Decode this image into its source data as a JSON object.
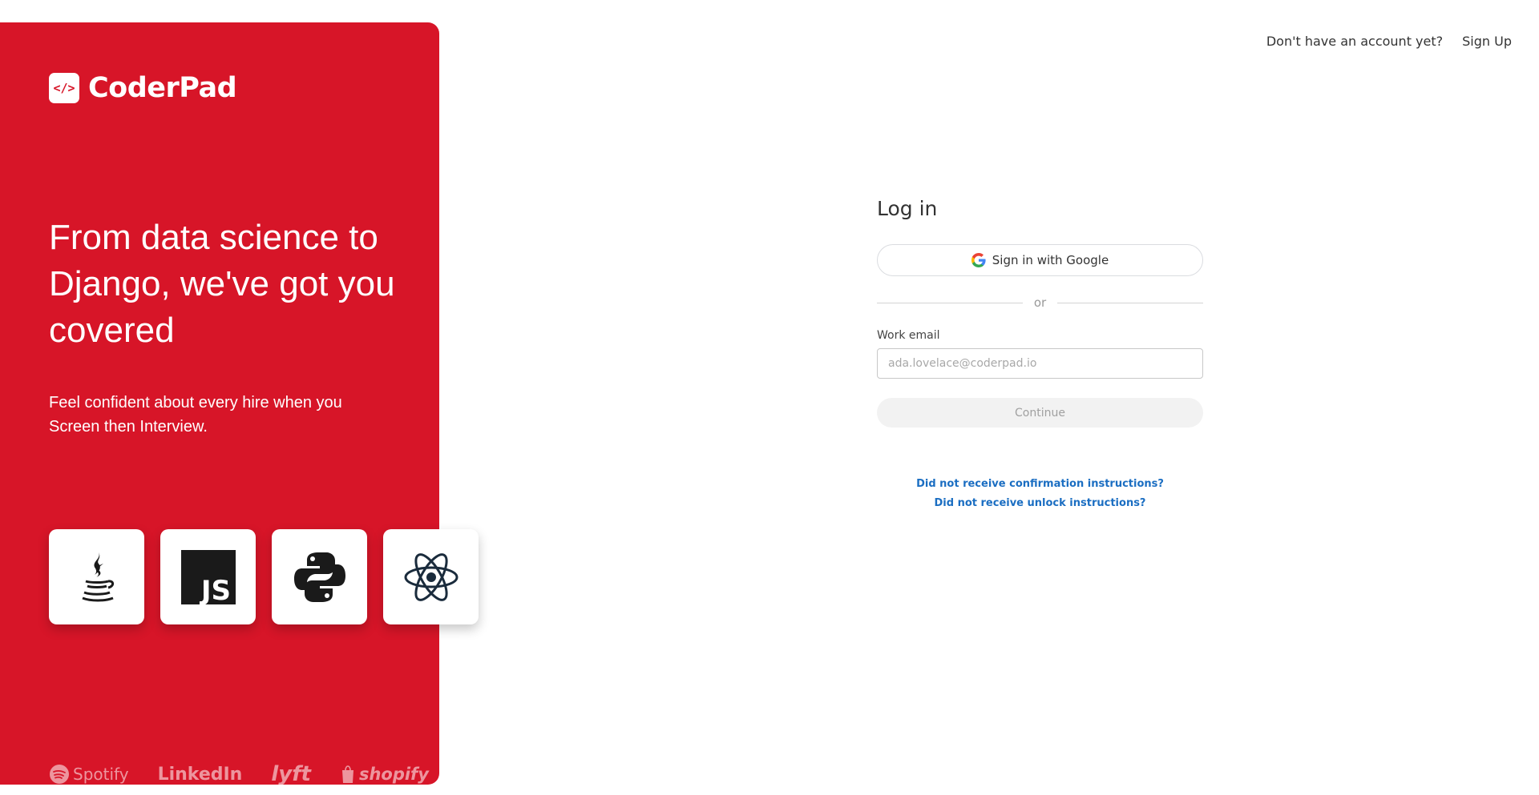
{
  "brand": {
    "logo_mark": "</>",
    "name": "CoderPad"
  },
  "hero": {
    "headline": "From data science to Django, we've got you covered",
    "subtext": "Feel confident about every hire when you Screen then Interview.",
    "language_icons": [
      "java-icon",
      "javascript-icon",
      "python-icon",
      "react-icon"
    ],
    "js_badge_text": "JS",
    "clients": [
      "Spotify",
      "LinkedIn",
      "lyft",
      "shopify"
    ]
  },
  "top_nav": {
    "prompt": "Don't have an account yet?",
    "signup_label": "Sign Up"
  },
  "login": {
    "title": "Log in",
    "google_label": "Sign in with Google",
    "divider_text": "or",
    "email_label": "Work email",
    "email_placeholder": "ada.lovelace@coderpad.io",
    "email_value": "",
    "continue_label": "Continue",
    "help_links": [
      "Did not receive confirmation instructions?",
      "Did not receive unlock instructions?"
    ]
  },
  "colors": {
    "brand_red": "#d71528",
    "link_blue": "#1b6ec2",
    "disabled_bg": "#f2f2f2"
  }
}
